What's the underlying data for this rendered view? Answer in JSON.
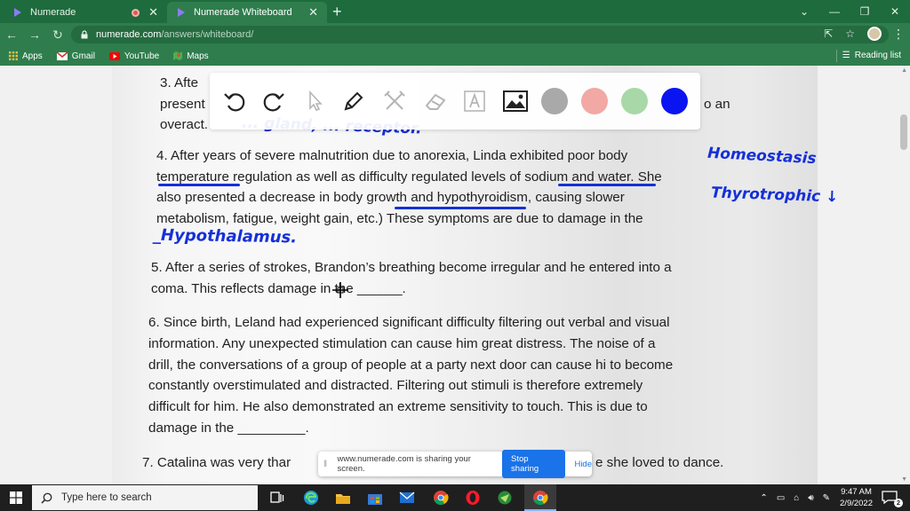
{
  "browser": {
    "tabs": [
      {
        "title": "Numerade",
        "active": false
      },
      {
        "title": "Numerade Whiteboard",
        "active": true
      }
    ],
    "new_tab_symbol": "+",
    "url_host": "numerade.com",
    "url_path": "/answers/whiteboard/",
    "bookmarks": [
      {
        "label": "Apps",
        "icon": "apps-grid-icon"
      },
      {
        "label": "Gmail",
        "icon": "gmail-icon"
      },
      {
        "label": "YouTube",
        "icon": "youtube-icon"
      },
      {
        "label": "Maps",
        "icon": "maps-icon"
      }
    ],
    "reading_list": "Reading list"
  },
  "whiteboard": {
    "tools": [
      "undo-icon",
      "redo-icon",
      "pointer-icon",
      "pen-icon",
      "tools-icon",
      "eraser-icon",
      "text-icon",
      "image-icon"
    ],
    "colors": [
      "#a9a9a9",
      "#f2a8a4",
      "#a8d8a8",
      "#0a14f0"
    ]
  },
  "document": {
    "q3_lines": [
      "3.  Afte",
      "present",
      "overact."
    ],
    "q3_tail": "o an",
    "q4_lines": [
      "4. After years of severe malnutrition due to anorexia, Linda exhibited poor body",
      "temperature regulation as well as difficulty regulated levels of sodium and water.  She",
      "also presented a decrease in body growth and hypothyroidism, causing slower",
      "metabolism, fatigue, weight gain, etc.)  These symptoms are due to damage in the"
    ],
    "q5_lines": [
      "5. After a series of strokes, Brandon’s breathing become irregular and he entered into a",
      "coma.  This reflects damage in the ______."
    ],
    "q6_lines": [
      "6. Since birth, Leland had experienced significant difficulty filtering out verbal and visual",
      "information.  Any unexpected stimulation can cause him great distress.  The noise of a",
      "drill, the conversations of a group of people at a party next door can cause hi to become",
      "constantly overstimulated and distracted.  Filtering out stimuli is therefore extremely",
      "difficult for him.  He also demonstrated an extreme sensitivity to touch.  This is due to",
      "damage in the _________."
    ],
    "q7_left": "7. Catalina was very thar",
    "q7_right": "e she loved to dance."
  },
  "handwriting": {
    "top_partial": "... gland, ... receptor.",
    "homeostasis": "Homeostasis",
    "thyrotrophic": "Thyrotrophic ↓",
    "hypothalamus": "_Hypothalamus."
  },
  "share_bar": {
    "message": "www.numerade.com is sharing your screen.",
    "stop_label": "Stop sharing",
    "hide_label": "Hide"
  },
  "taskbar": {
    "search_placeholder": "Type here to search",
    "time": "9:47 AM",
    "date": "2/9/2022",
    "notification_count": "2"
  }
}
